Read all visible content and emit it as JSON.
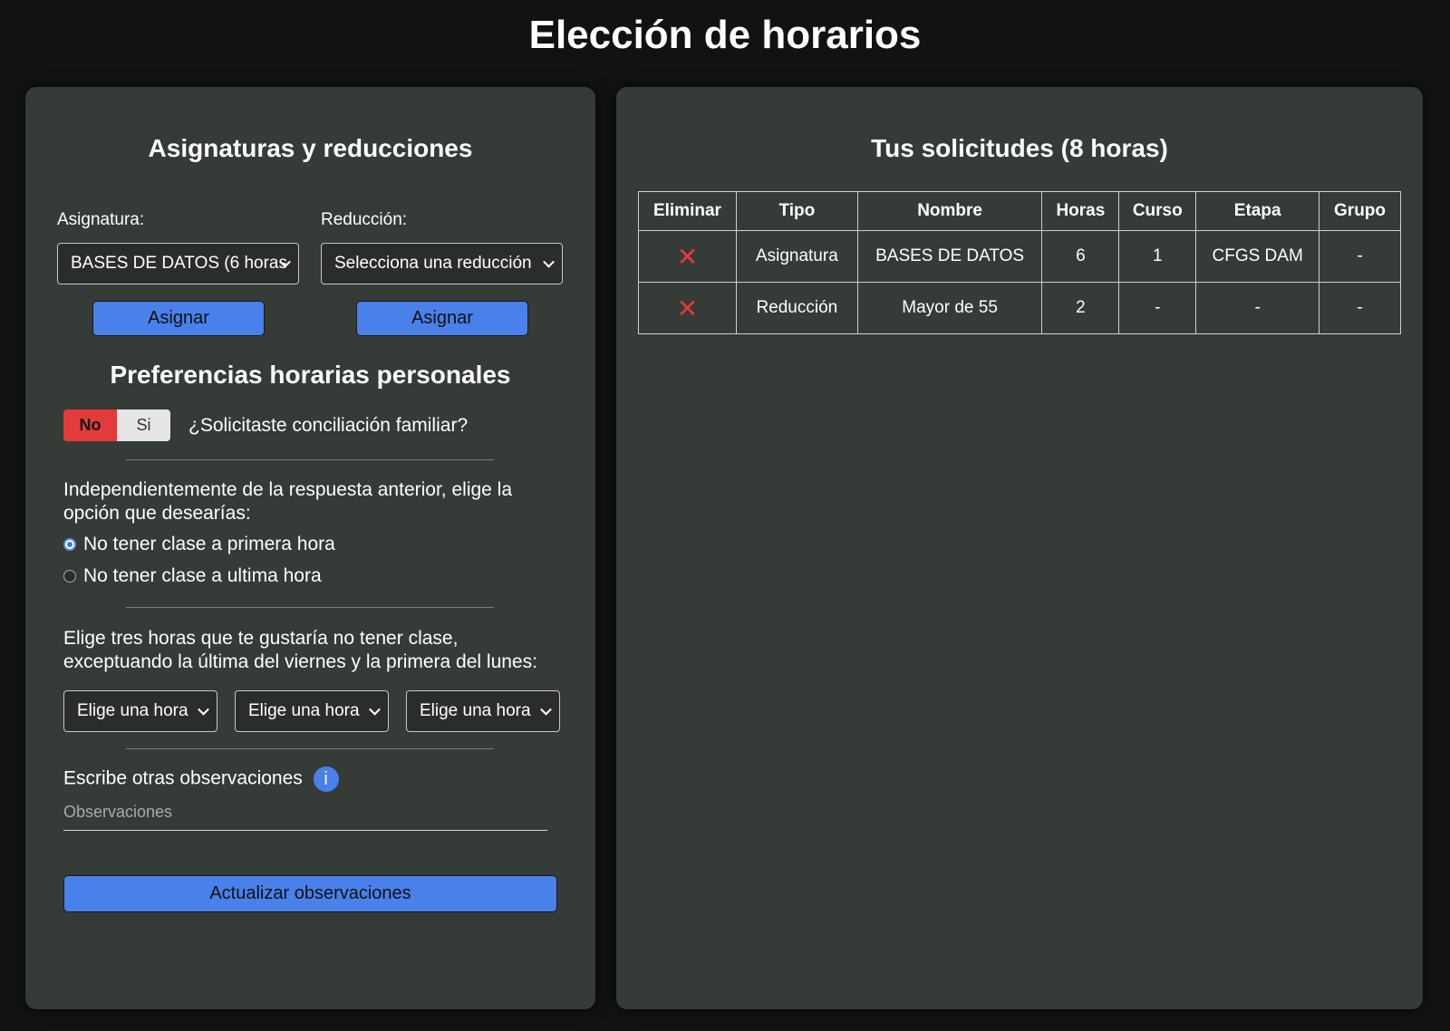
{
  "page": {
    "title": "Elección de horarios"
  },
  "left": {
    "title": "Asignaturas y reducciones",
    "asignatura_label": "Asignatura:",
    "asignatura_value": "BASES DE DATOS (6 horas",
    "reduccion_label": "Reducción:",
    "reduccion_value": "Selecciona una reducción",
    "assign_label": "Asignar",
    "assign_label_2": "Asignar"
  },
  "prefs": {
    "title": "Preferencias horarias personales",
    "toggle_no": "No",
    "toggle_si": "Si",
    "toggle_selected": "No",
    "conciliacion_question": "¿Solicitaste conciliación familiar?",
    "option_intro": "Independientemente de la respuesta anterior, elige la opción que desearías:",
    "radio_options": [
      {
        "label": "No tener clase a primera hora",
        "checked": true
      },
      {
        "label": "No tener clase a ultima hora",
        "checked": false
      }
    ],
    "hours_intro": "Elige tres horas que te gustaría no tener clase, exceptuando la última del viernes y la primera del lunes:",
    "hour_selects": [
      "Elige una hora",
      "Elige una hora",
      "Elige una hora"
    ],
    "obs_label": "Escribe otras observaciones",
    "info_icon": "i",
    "obs_placeholder": "Observaciones",
    "update_button": "Actualizar observaciones"
  },
  "requests": {
    "title": "Tus solicitudes (8 horas)",
    "columns": [
      "Eliminar",
      "Tipo",
      "Nombre",
      "Horas",
      "Curso",
      "Etapa",
      "Grupo"
    ],
    "delete_glyph": "✕",
    "rows": [
      {
        "tipo": "Asignatura",
        "nombre": "BASES DE DATOS",
        "horas": "6",
        "curso": "1",
        "etapa": "CFGS DAM",
        "grupo": "-"
      },
      {
        "tipo": "Reducción",
        "nombre": "Mayor de 55",
        "horas": "2",
        "curso": "-",
        "etapa": "-",
        "grupo": "-"
      }
    ]
  },
  "colors": {
    "background": "#111212",
    "panel": "#353b37",
    "accent_blue": "#4a80ea",
    "danger_red": "#e43a3b"
  }
}
